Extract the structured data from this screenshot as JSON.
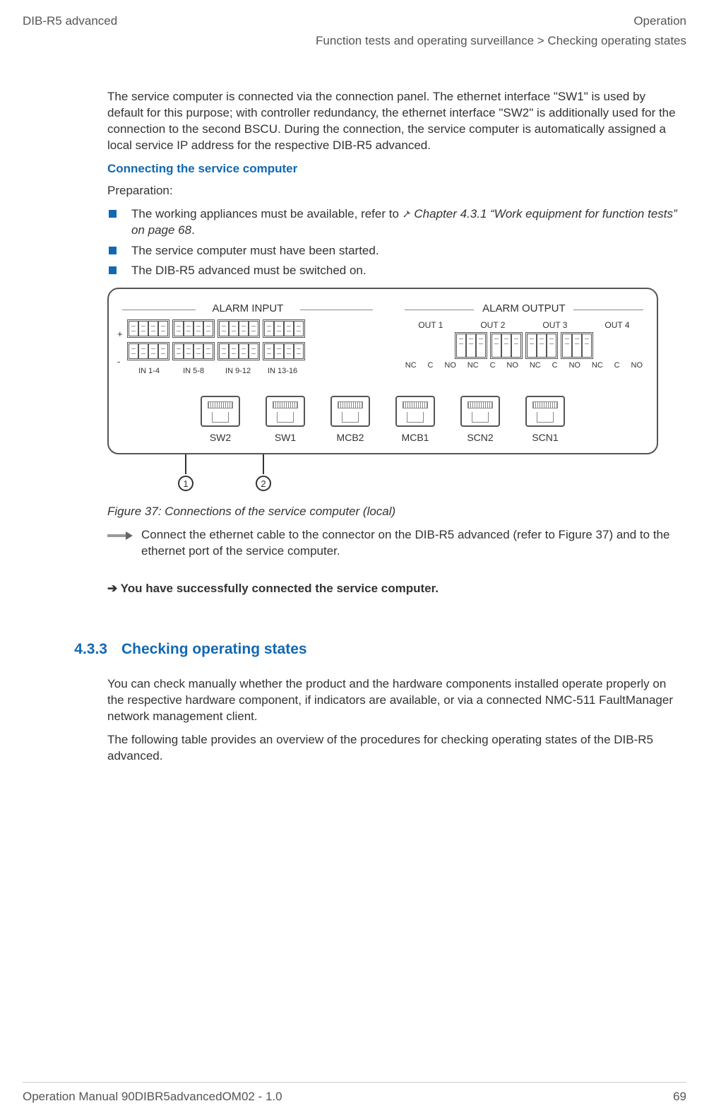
{
  "header": {
    "left": "DIB-R5 advanced",
    "right": "Operation",
    "breadcrumb": "Function tests and operating surveillance > Checking operating states"
  },
  "intro": "The service computer is connected via the connection panel. The ethernet interface \"SW1\" is used by default for this purpose; with controller redundancy, the ethernet interface \"SW2\" is additionally used for the connection to the second BSCU. During the connection, the service computer is automatically assigned a local service IP address for the respective DIB-R5 advanced.",
  "subhead1": "Connecting the service computer",
  "prep_label": "Preparation:",
  "bullets": [
    {
      "pre": "The working appliances must be available, refer to ",
      "ref": "Chapter 4.3.1 “Work equipment for function tests” on page 68",
      "post": "."
    },
    {
      "pre": "The service computer must have been started.",
      "ref": "",
      "post": ""
    },
    {
      "pre": "The DIB-R5 advanced must be switched on.",
      "ref": "",
      "post": ""
    }
  ],
  "figure": {
    "alarm_input_title": "ALARM INPUT",
    "alarm_output_title": "ALARM OUTPUT",
    "plus": "+",
    "minus": "-",
    "in_labels": [
      "IN 1-4",
      "IN 5-8",
      "IN 9-12",
      "IN 13-16"
    ],
    "out_labels": [
      "OUT 1",
      "OUT 2",
      "OUT 3",
      "OUT 4"
    ],
    "nc": "NC",
    "c": "C",
    "no": "NO",
    "rj": [
      "SW2",
      "SW1",
      "MCB2",
      "MCB1",
      "SCN2",
      "SCN1"
    ],
    "callouts": [
      "1",
      "2"
    ]
  },
  "caption": "Figure 37: Connections of the service computer (local)",
  "step": "Connect the ethernet cable to the connector on the DIB-R5 advanced (refer to Figure 37) and to the ethernet port of the service computer.",
  "result": "➔ You have successfully connected the service computer.",
  "section": {
    "num": "4.3.3",
    "title": "Checking operating states"
  },
  "body2a": "You can check manually whether the product and the hardware components installed operate properly on the respective hardware component, if indicators are available, or via a connected NMC-511 FaultManager network management client.",
  "body2b": "The following table provides an overview of the procedures for checking operating states of the DIB-R5 advanced.",
  "footer": {
    "left": "Operation Manual 90DIBR5advancedOM02 - 1.0",
    "right": "69"
  }
}
